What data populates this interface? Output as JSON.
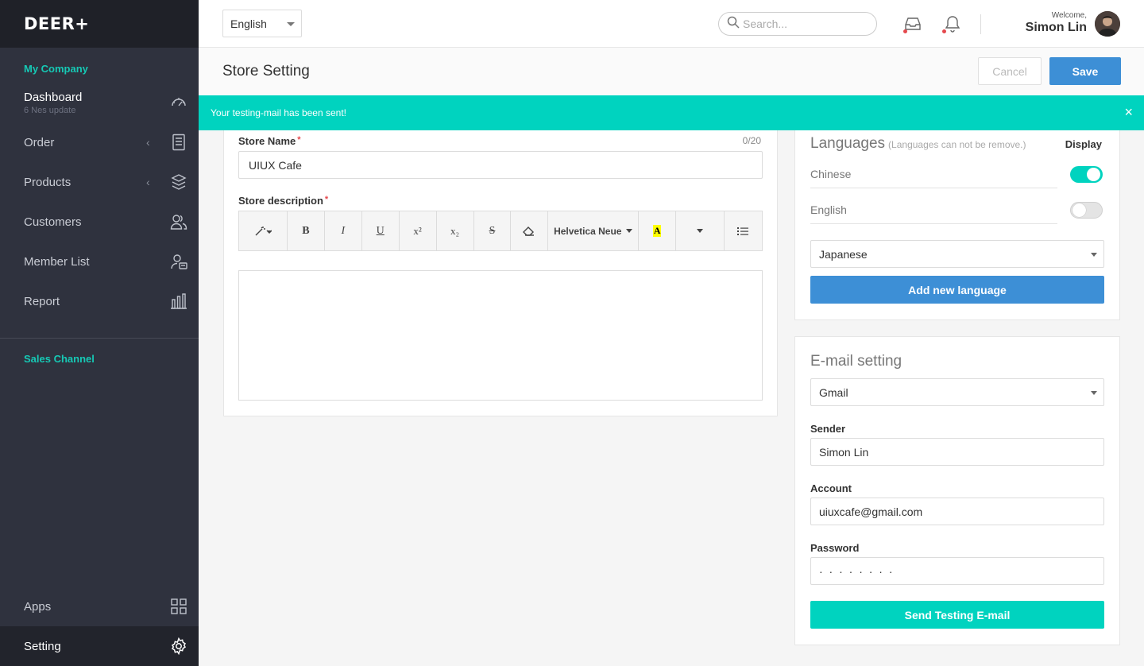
{
  "sidebar": {
    "logo": "DEER+",
    "section_company": "My Company",
    "section_sales": "Sales Channel",
    "items": [
      {
        "label": "Dashboard",
        "sub": "6 Nes update",
        "icon": "speedometer-icon"
      },
      {
        "label": "Order",
        "icon": "document-icon"
      },
      {
        "label": "Products",
        "icon": "box-icon"
      },
      {
        "label": "Customers",
        "icon": "users-icon"
      },
      {
        "label": "Member List",
        "icon": "member-card-icon"
      },
      {
        "label": "Report",
        "icon": "bar-chart-icon"
      },
      {
        "label": "Apps",
        "icon": "grid-icon"
      },
      {
        "label": "Setting",
        "icon": "gear-icon"
      }
    ]
  },
  "header": {
    "language": "English",
    "search_placeholder": "Search...",
    "welcome": "Welcome,",
    "user_name": "Simon Lin"
  },
  "page": {
    "title": "Store Setting",
    "cancel_label": "Cancel",
    "save_label": "Save"
  },
  "alert": {
    "message": "Your testing-mail has been sent!",
    "close": "×"
  },
  "store": {
    "name_label": "Store Name",
    "name_counter": "0/20",
    "name_value": "UIUX Cafe",
    "description_label": "Store description",
    "required_mark": "*",
    "toolbar": {
      "bold": "B",
      "italic": "I",
      "underline": "U",
      "superscript": "x²",
      "subscript": "x₂",
      "strikethrough": "S",
      "font": "Helvetica Neue",
      "highlight": "A"
    }
  },
  "languages": {
    "title": "Languages",
    "hint": "(Languages can not be remove.)",
    "display_label": "Display",
    "rows": [
      {
        "name": "Chinese",
        "enabled": true
      },
      {
        "name": "English",
        "enabled": false
      }
    ],
    "select_value": "Japanese",
    "add_button": "Add new language"
  },
  "email": {
    "title": "E-mail setting",
    "provider": "Gmail",
    "sender_label": "Sender",
    "sender_value": "Simon Lin",
    "account_label": "Account",
    "account_value": "uiuxcafe@gmail.com",
    "password_label": "Password",
    "password_value": "· · · · · · · ·",
    "send_button": "Send Testing E-mail"
  },
  "colors": {
    "accent_teal": "#00d3bf",
    "primary_blue": "#3d8fd6",
    "sidebar_bg": "#2f323e",
    "notification_dot": "#e5484d"
  }
}
